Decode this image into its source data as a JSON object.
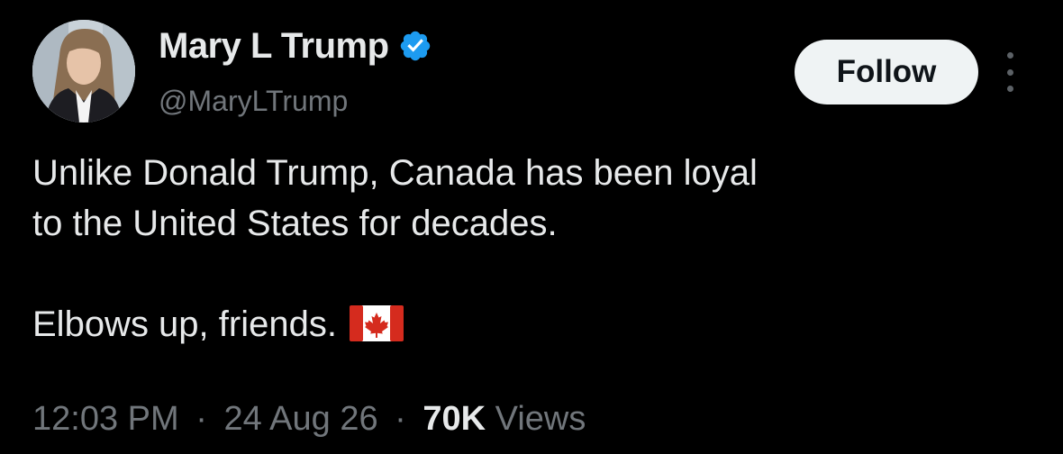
{
  "author": {
    "display_name": "Mary L Trump",
    "handle": "@MaryLTrump",
    "verified_icon": "verified-badge-icon",
    "verified_color": "#1d9bf0"
  },
  "actions": {
    "follow_label": "Follow",
    "more_icon": "more-vertical-icon"
  },
  "tweet": {
    "line1": "Unlike Donald Trump, Canada has been loyal",
    "line2": "to the United States for decades.",
    "line3": "Elbows up, friends.",
    "emoji_icon": "canada-flag-icon"
  },
  "meta": {
    "time": "12:03 PM",
    "separator": "·",
    "date": "24 Aug 26",
    "views_count": "70K",
    "views_label": "Views"
  },
  "colors": {
    "background": "#000000",
    "primary_text": "#e7e9ea",
    "secondary_text": "#71767b",
    "follow_button_bg": "#eff3f4",
    "follow_button_text": "#0f1419",
    "flag_red": "#d52b1e"
  }
}
